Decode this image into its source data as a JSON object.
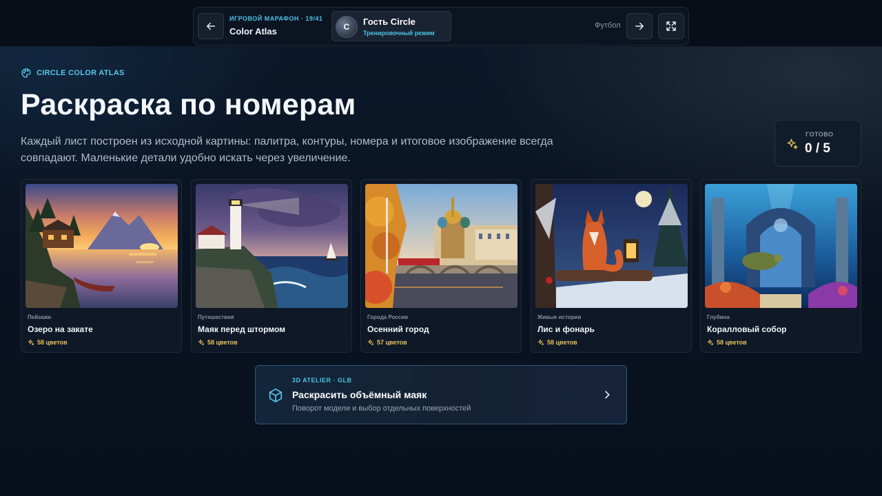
{
  "topbar": {
    "marathon_label": "ИГРОВОЙ МАРАФОН · 19/41",
    "app_title": "Color Atlas",
    "user": {
      "initial": "C",
      "name": "Гость Circle",
      "mode": "Тренировочный режим"
    },
    "sport_label": "Футбол",
    "icons": {
      "back": "arrow-left-icon",
      "next": "arrow-right-icon",
      "fullscreen": "expand-icon"
    }
  },
  "header": {
    "eyebrow": "CIRCLE COLOR ATLAS",
    "eyebrow_icon": "palette-icon",
    "title": "Раскраска по номерам",
    "description": "Каждый лист построен из исходной картины: палитра, контуры, номера и итоговое изображение всегда совпадают. Маленькие детали удобно искать через увеличение."
  },
  "progress": {
    "label": "ГОТОВО",
    "value": "0 / 5",
    "icon": "sparkles-icon"
  },
  "cards": [
    {
      "category": "Пейзажи",
      "title": "Озеро на закате",
      "colors": "58 цветов"
    },
    {
      "category": "Путешествия",
      "title": "Маяк перед штормом",
      "colors": "58 цветов"
    },
    {
      "category": "Города России",
      "title": "Осенний город",
      "colors": "57 цветов"
    },
    {
      "category": "Живые истории",
      "title": "Лис и фонарь",
      "colors": "58 цветов"
    },
    {
      "category": "Глубина",
      "title": "Коралловый собор",
      "colors": "58 цветов"
    }
  ],
  "atelier": {
    "tag": "3D ATELIER · GLB",
    "title": "Раскрасить объёмный маяк",
    "subtitle": "Поворот модели и выбор отдельных поверхностей",
    "icon": "cube-icon"
  },
  "colors": {
    "accent": "#4cc3e6",
    "gold": "#e7c25a",
    "background": "#0a1220"
  }
}
